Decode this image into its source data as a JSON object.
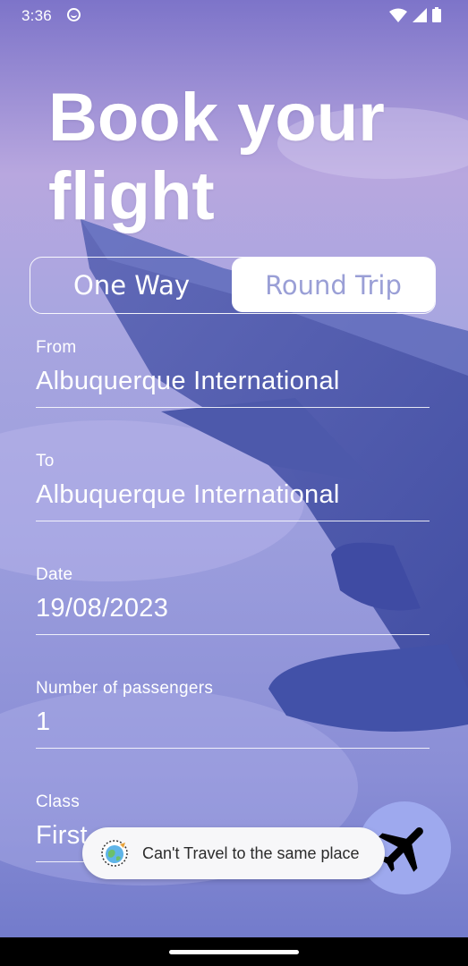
{
  "status_bar": {
    "time": "3:36",
    "icons": [
      "sync-circle-icon",
      "wifi-icon",
      "signal-icon",
      "battery-icon"
    ]
  },
  "header": {
    "title": "Book your flight"
  },
  "trip_type": {
    "options": [
      "One Way",
      "Round Trip"
    ],
    "selected": "Round Trip"
  },
  "form": {
    "from": {
      "label": "From",
      "value": "Albuquerque International"
    },
    "to": {
      "label": "To",
      "value": "Albuquerque International"
    },
    "date": {
      "label": "Date",
      "value": "19/08/2023"
    },
    "passengers": {
      "label": "Number of passengers",
      "value": "1"
    },
    "class": {
      "label": "Class",
      "value": "First"
    }
  },
  "fab": {
    "icon": "airplane-icon"
  },
  "toast": {
    "icon": "globe-travel-icon",
    "message": "Can't Travel to the same place"
  },
  "colors": {
    "sky": "#7a82c8",
    "toggle_selected_text": "#9a9fd6",
    "fab": "#9ea9ee"
  }
}
